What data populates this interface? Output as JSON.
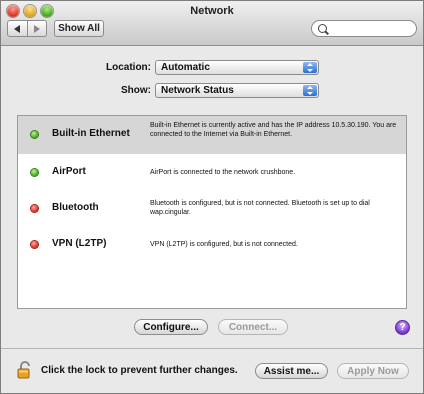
{
  "window": {
    "title": "Network"
  },
  "toolbar": {
    "show_all_label": "Show All",
    "search_placeholder": ""
  },
  "location": {
    "label": "Location:",
    "value": "Automatic"
  },
  "show": {
    "label": "Show:",
    "value": "Network Status"
  },
  "services": [
    {
      "name": "Built-in Ethernet",
      "status": "green",
      "description": "Built-in Ethernet is currently active and has the IP address 10.5.30.190. You are connected to the Internet via Built-in Ethernet."
    },
    {
      "name": "AirPort",
      "status": "green",
      "description": "AirPort is connected to the network crushbone."
    },
    {
      "name": "Bluetooth",
      "status": "red",
      "description": "Bluetooth is configured, but is not connected. Bluetooth is set up to dial wap.cingular."
    },
    {
      "name": "VPN (L2TP)",
      "status": "red",
      "description": "VPN (L2TP) is configured, but is not connected."
    }
  ],
  "buttons": {
    "configure": "Configure...",
    "connect": "Connect...",
    "help": "?",
    "assist": "Assist me...",
    "apply": "Apply Now"
  },
  "lock": {
    "text": "Click the lock to prevent further changes."
  },
  "colors": {
    "status_green": "#3ea11c",
    "status_red": "#d32518",
    "selection": "#d6d6d6"
  }
}
